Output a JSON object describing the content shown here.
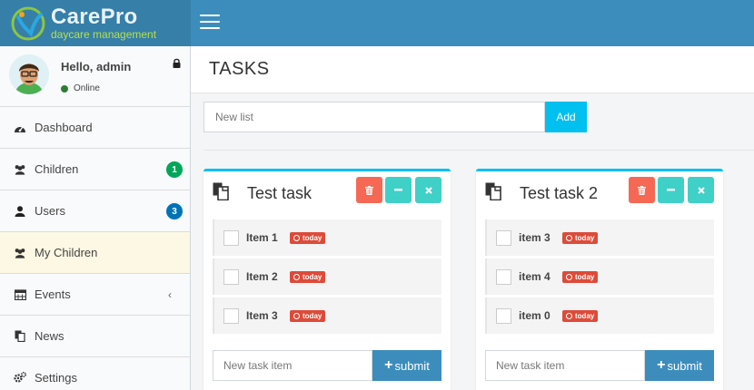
{
  "brand": {
    "title": "CarePro",
    "subtitle": "daycare management"
  },
  "user": {
    "greeting": "Hello, admin",
    "status": "Online"
  },
  "sidebar": {
    "items": [
      {
        "label": "Dashboard",
        "icon": "dashboard-icon"
      },
      {
        "label": "Children",
        "icon": "users-icon",
        "badge": "1",
        "badge_color": "#00a65a"
      },
      {
        "label": "Users",
        "icon": "user-icon",
        "badge": "3",
        "badge_color": "#0073b7"
      },
      {
        "label": "My Children",
        "icon": "users-icon",
        "active": true
      },
      {
        "label": "Events",
        "icon": "calendar-icon",
        "chevron": "‹"
      },
      {
        "label": "News",
        "icon": "copy-icon"
      },
      {
        "label": "Settings",
        "icon": "gears-icon"
      }
    ]
  },
  "page": {
    "title": "TASKS"
  },
  "new_list": {
    "placeholder": "New list",
    "add_label": "Add"
  },
  "lists": [
    {
      "title": "Test task",
      "items": [
        {
          "label": "Item 1",
          "badge": "today"
        },
        {
          "label": "Item 2",
          "badge": "today"
        },
        {
          "label": "Item 3",
          "badge": "today"
        }
      ],
      "input_placeholder": "New task item",
      "submit_label": "submit"
    },
    {
      "title": "Test task 2",
      "items": [
        {
          "label": "item 3",
          "badge": "today"
        },
        {
          "label": "item 4",
          "badge": "today"
        },
        {
          "label": "item 0",
          "badge": "today"
        }
      ],
      "input_placeholder": "New task item",
      "submit_label": "submit"
    }
  ],
  "colors": {
    "header": "#3c8dbc",
    "logo_bg": "#367fa9",
    "accent": "#00c0ef",
    "danger": "#f56954",
    "teal": "#3fd0c8",
    "today_badge": "#dd4b39",
    "active_nav": "#fcf8e3"
  }
}
